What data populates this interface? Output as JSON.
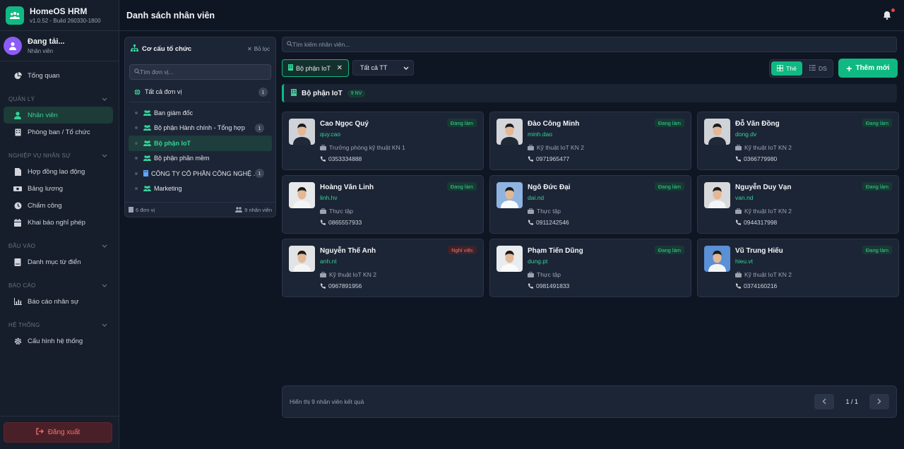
{
  "app": {
    "name": "HomeOS HRM",
    "version": "v1.0.52 - Build 260330-1800"
  },
  "user": {
    "name": "Đang tải...",
    "role": "Nhân viên"
  },
  "sidebar": {
    "overview": "Tổng quan",
    "groups": [
      {
        "title": "QUẢN LÝ",
        "items": [
          "Nhân viên",
          "Phòng ban / Tổ chức"
        ]
      },
      {
        "title": "NGHIỆP VỤ NHÂN SỰ",
        "items": [
          "Hợp đồng lao động",
          "Bảng lương",
          "Chấm công",
          "Khai báo nghỉ phép"
        ]
      },
      {
        "title": "ĐẦU VÀO",
        "items": [
          "Danh mục từ điển"
        ]
      },
      {
        "title": "BÁO CÁO",
        "items": [
          "Báo cáo nhân sự"
        ]
      },
      {
        "title": "HỆ THỐNG",
        "items": [
          "Cấu hình hệ thống"
        ]
      }
    ],
    "logout": "Đăng xuất"
  },
  "header": {
    "title": "Danh sách nhân viên"
  },
  "org": {
    "title": "Cơ cấu tổ chức",
    "clear": "Bỏ lọc",
    "search_placeholder": "Tìm đơn vị...",
    "all_label": "Tất cả đơn vị",
    "all_count": "1",
    "items": [
      {
        "label": "Ban giám đốc",
        "count": ""
      },
      {
        "label": "Bộ phận Hành chính - Tổng hợp",
        "count": "1"
      },
      {
        "label": "Bộ phận IoT",
        "count": ""
      },
      {
        "label": "Bộ phận phần mềm",
        "count": ""
      },
      {
        "label": "CÔNG TY CỔ PHẦN CÔNG NGHỆ ...",
        "count": "1"
      },
      {
        "label": "Marketing",
        "count": ""
      }
    ],
    "footer_units": "6 đơn vị",
    "footer_staff": "9 nhân viên"
  },
  "main": {
    "search_placeholder": "Tìm kiếm nhân viên...",
    "filter_chip": "Bộ phận IoT",
    "status_select": "Tất cả TT",
    "view_card": "Thẻ",
    "view_list": "DS",
    "add_button": "Thêm mới",
    "group_title": "Bộ phận IoT",
    "group_count": "9 NV"
  },
  "employees": [
    {
      "name": "Cao Ngọc Quý",
      "username": "quy.cao",
      "position": "Trưởng phòng kỹ thuật KN 1",
      "phone": "0353334888",
      "status": "Đang làm"
    },
    {
      "name": "Đào Công Minh",
      "username": "minh.dao",
      "position": "Kỹ thuật IoT KN 2",
      "phone": "0971965477",
      "status": "Đang làm"
    },
    {
      "name": "Đỗ Văn Đồng",
      "username": "dong.dv",
      "position": "Kỹ thuật IoT KN 2",
      "phone": "0366779980",
      "status": "Đang làm"
    },
    {
      "name": "Hoàng Văn Linh",
      "username": "linh.hv",
      "position": "Thực tập",
      "phone": "0865557933",
      "status": "Đang làm"
    },
    {
      "name": "Ngô Đức Đại",
      "username": "dai.nd",
      "position": "Thực tập",
      "phone": "0911242546",
      "status": "Đang làm"
    },
    {
      "name": "Nguyễn Duy Vạn",
      "username": "van.nd",
      "position": "Kỹ thuật IoT KN 2",
      "phone": "0944317998",
      "status": "Đang làm"
    },
    {
      "name": "Nguyễn Thế Anh",
      "username": "anh.nt",
      "position": "Kỹ thuật IoT KN 2",
      "phone": "0967891956",
      "status": "Nghỉ việc"
    },
    {
      "name": "Phạm Tiến Dũng",
      "username": "dung.pt",
      "position": "Thực tập",
      "phone": "0981491833",
      "status": "Đang làm"
    },
    {
      "name": "Vũ Trung Hiếu",
      "username": "hieu.vt",
      "position": "Kỹ thuật IoT KN 2",
      "phone": "0374160216",
      "status": "Đang làm"
    }
  ],
  "pager": {
    "info": "Hiển thị 9 nhân viên kết quả",
    "page": "1 / 1"
  },
  "colors": {
    "accent": "#10b981",
    "bg": "#0f1623",
    "panel": "#1c2536",
    "danger": "#f87171"
  }
}
